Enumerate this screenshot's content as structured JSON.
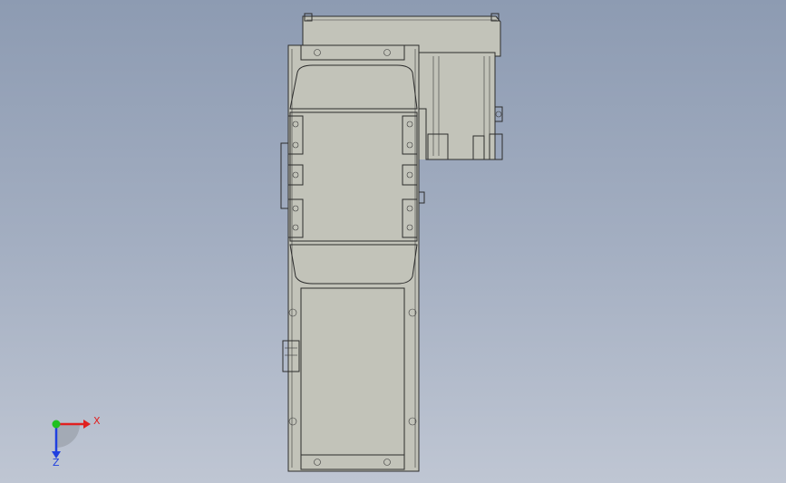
{
  "viewport": {
    "background_top": "#8d9bb2",
    "background_bottom": "#bfc6d3"
  },
  "model": {
    "body_color": "#c2c3b9",
    "edge_color": "#2c2c2c"
  },
  "triad": {
    "x_label": "X",
    "z_label": "Z",
    "x_color": "#e02020",
    "y_color": "#20c020",
    "z_color": "#2040e0"
  }
}
